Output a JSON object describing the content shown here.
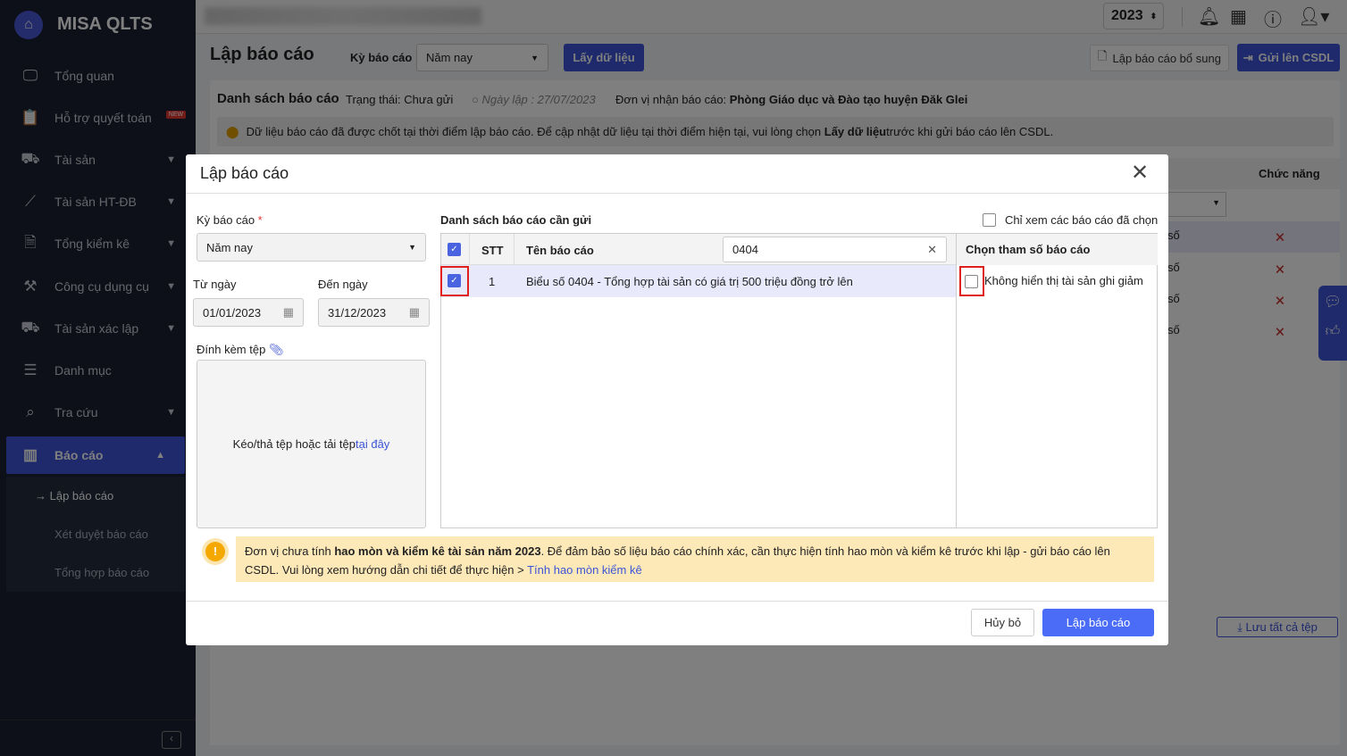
{
  "app": {
    "brand": "MISA QLTS",
    "year": "2023"
  },
  "sidebar": {
    "items": [
      {
        "label": "Tổng quan",
        "icon": "monitor-chart-icon"
      },
      {
        "label": "Hỗ trợ quyết toán",
        "icon": "clipboard-icon",
        "badge": "NEW"
      },
      {
        "label": "Tài sản",
        "icon": "car-house-icon"
      },
      {
        "label": "Tài sản HT-ĐB",
        "icon": "road-icon"
      },
      {
        "label": "Tổng kiểm kê",
        "icon": "audit-icon"
      },
      {
        "label": "Công cụ dụng cụ",
        "icon": "tool-icon"
      },
      {
        "label": "Tài sản xác lập",
        "icon": "asset-icon"
      },
      {
        "label": "Danh mục",
        "icon": "list-icon"
      },
      {
        "label": "Tra cứu",
        "icon": "search-icon"
      },
      {
        "label": "Báo cáo",
        "icon": "chart-icon"
      }
    ],
    "sub_items": [
      "→ Lập báo cáo",
      "Xét duyệt báo cáo",
      "Tổng hợp báo cáo"
    ]
  },
  "page": {
    "title": "Lập báo cáo",
    "period_label": "Kỳ báo cáo",
    "period_value": "Năm nay",
    "fetch_button": "Lấy dữ liệu",
    "supplement_button": "Lập báo cáo bổ sung",
    "send_button": "Gửi lên CSDL",
    "list_title": "Danh sách báo cáo",
    "status": "Trạng thái: Chưa gửi",
    "created": "Ngày lập : 27/07/2023",
    "recipient_label": "Đơn vị nhận báo cáo:",
    "recipient": "Phòng Giáo dục và Đào tạo huyện Đăk Glei",
    "notice_a": "Dữ liệu báo cáo đã được chốt tại thời điểm lập báo cáo. Để cập nhật dữ liệu tại thời điểm hiện tại, vui lòng chọn ",
    "notice_b": "Lấy dữ liệu",
    "notice_c": " trước khi gửi báo cáo lên CSDL.",
    "function_col": "Chức năng",
    "row_suffix": "số",
    "save_all": "Lưu tất cả tệp"
  },
  "modal": {
    "title": "Lập báo cáo",
    "period_label": "Kỳ báo cáo",
    "required": "*",
    "period_value": "Năm nay",
    "from_label": "Từ ngày",
    "from_value": "01/01/2023",
    "to_label": "Đến ngày",
    "to_value": "31/12/2023",
    "attach_label": "Đính kèm tệp",
    "drop_text": "Kéo/thả tệp hoặc tải tệp ",
    "drop_link": "tại đây",
    "list_title": "Danh sách báo cáo cần gửi",
    "only_selected": "Chỉ xem các báo cáo đã chọn",
    "columns": {
      "stt": "STT",
      "name": "Tên báo cáo"
    },
    "search_value": "0404",
    "rows": [
      {
        "stt": "1",
        "name": "Biểu số 0404 - Tổng hợp tài sản có giá trị 500 triệu đồng trở lên",
        "checked": true
      }
    ],
    "params_title": "Chọn tham số báo cáo",
    "param_option": "Không hiển thị tài sản ghi giảm",
    "warn_a": "Đơn vị chưa tính ",
    "warn_b": "hao mòn và kiểm kê tài sản năm 2023",
    "warn_c": ". Để đảm bảo số liệu báo cáo chính xác, cần thực hiện tính hao mòn và kiểm kê trước khi lập - gửi báo cáo lên CSDL. Vui lòng xem hướng dẫn chi tiết để thực hiện > ",
    "warn_link": "Tính hao mòn kiểm kê",
    "cancel": "Hủy bỏ",
    "submit": "Lập báo cáo"
  },
  "colors": {
    "primary": "#3d55d6",
    "highlight": "#e0201c",
    "warning_bg": "#fde8b8"
  }
}
